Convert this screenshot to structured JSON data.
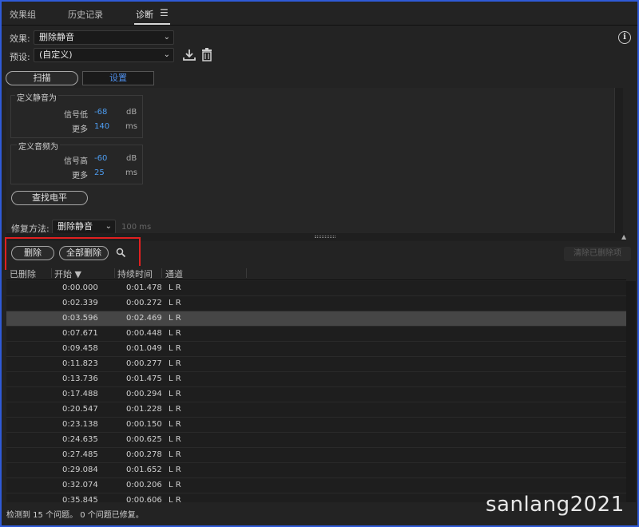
{
  "tabs": [
    {
      "label": "效果组",
      "active": false
    },
    {
      "label": "历史记录",
      "active": false
    },
    {
      "label": "诊断",
      "active": true
    }
  ],
  "tab_menu_icon": "hamburger-menu-icon",
  "effect": {
    "label": "效果:",
    "value": "删除静音"
  },
  "preset": {
    "label": "预设:",
    "value": "(自定义)"
  },
  "toolbar_icons": [
    "download-icon",
    "trash-icon",
    "info-icon"
  ],
  "mode_tabs": {
    "scan": "扫描",
    "settings": "设置"
  },
  "define_silence": {
    "title": "定义静音为",
    "signal_label": "信号低",
    "signal_value": "-68",
    "signal_unit": "dB",
    "more_label": "更多",
    "more_value": "140",
    "more_unit": "ms"
  },
  "define_audio": {
    "title": "定义音频为",
    "signal_label": "信号高",
    "signal_value": "-60",
    "signal_unit": "dB",
    "more_label": "更多",
    "more_value": "25",
    "more_unit": "ms"
  },
  "find_level_button": "查找电平",
  "repair": {
    "label": "修复方法:",
    "value": "删除静音",
    "faded": "100 ms"
  },
  "actions": {
    "delete": "删除",
    "delete_all": "全部删除",
    "clear_deleted": "清除已删除项"
  },
  "columns": {
    "deleted": "已删除",
    "start": "开始",
    "duration": "持续时间",
    "channel": "通道"
  },
  "rows": [
    {
      "start": "0:00.000",
      "duration": "0:01.478",
      "channel": "L R"
    },
    {
      "start": "0:02.339",
      "duration": "0:00.272",
      "channel": "L R"
    },
    {
      "start": "0:03.596",
      "duration": "0:02.469",
      "channel": "L R"
    },
    {
      "start": "0:07.671",
      "duration": "0:00.448",
      "channel": "L R"
    },
    {
      "start": "0:09.458",
      "duration": "0:01.049",
      "channel": "L R"
    },
    {
      "start": "0:11.823",
      "duration": "0:00.277",
      "channel": "L R"
    },
    {
      "start": "0:13.736",
      "duration": "0:01.475",
      "channel": "L R"
    },
    {
      "start": "0:17.488",
      "duration": "0:00.294",
      "channel": "L R"
    },
    {
      "start": "0:20.547",
      "duration": "0:01.228",
      "channel": "L R"
    },
    {
      "start": "0:23.138",
      "duration": "0:00.150",
      "channel": "L R"
    },
    {
      "start": "0:24.635",
      "duration": "0:00.625",
      "channel": "L R"
    },
    {
      "start": "0:27.485",
      "duration": "0:00.278",
      "channel": "L R"
    },
    {
      "start": "0:29.084",
      "duration": "0:01.652",
      "channel": "L R"
    },
    {
      "start": "0:32.074",
      "duration": "0:00.206",
      "channel": "L R"
    },
    {
      "start": "0:35.845",
      "duration": "0:00.606",
      "channel": "L R"
    }
  ],
  "selected_row": 2,
  "status": "检测到 15 个问题。 0 个问题已修复。",
  "watermark": "sanlang2021",
  "colors": {
    "accent": "#4d9cf0",
    "highlight_box": "#e12020",
    "window_border": "#2f5bd8"
  }
}
